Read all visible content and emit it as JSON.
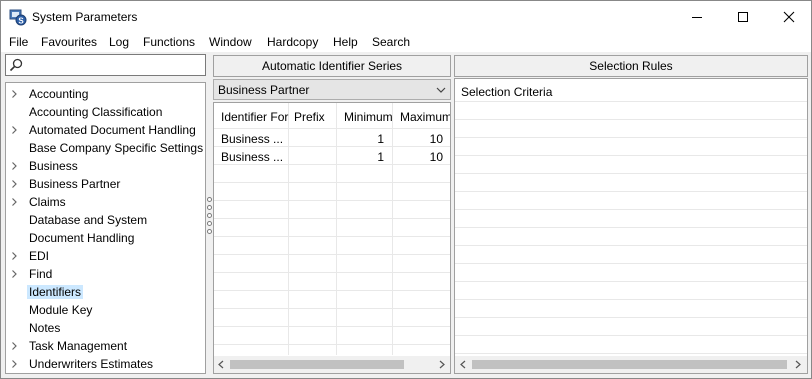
{
  "window": {
    "title": "System Parameters"
  },
  "menu": [
    "File",
    "Favourites",
    "Log",
    "Functions",
    "Window",
    "Hardcopy",
    "Help",
    "Search"
  ],
  "search": {
    "value": "",
    "placeholder": ""
  },
  "tree": {
    "items": [
      {
        "label": "Accounting",
        "expandable": true
      },
      {
        "label": "Accounting Classification",
        "expandable": false
      },
      {
        "label": "Automated Document Handling",
        "expandable": true
      },
      {
        "label": "Base Company Specific Settings",
        "expandable": false
      },
      {
        "label": "Business",
        "expandable": true
      },
      {
        "label": "Business Partner",
        "expandable": true
      },
      {
        "label": "Claims",
        "expandable": true
      },
      {
        "label": "Database and System",
        "expandable": false
      },
      {
        "label": "Document Handling",
        "expandable": false
      },
      {
        "label": "EDI",
        "expandable": true
      },
      {
        "label": "Find",
        "expandable": true
      },
      {
        "label": "Identifiers",
        "expandable": false,
        "selected": true
      },
      {
        "label": "Module Key",
        "expandable": false
      },
      {
        "label": "Notes",
        "expandable": false
      },
      {
        "label": "Task Management",
        "expandable": true
      },
      {
        "label": "Underwriters Estimates",
        "expandable": true
      }
    ]
  },
  "identifier_series": {
    "header": "Automatic Identifier Series",
    "combo_value": "Business Partner",
    "columns": [
      "Identifier For",
      "Prefix",
      "Minimum",
      "Maximum"
    ],
    "rows": [
      [
        "Business ...",
        "",
        "1",
        "10"
      ],
      [
        "Business ...",
        "",
        "1",
        "10"
      ]
    ]
  },
  "selection_rules": {
    "header": "Selection Rules",
    "criteria_label": "Selection Criteria"
  },
  "colors": {
    "selection": "#cce8ff",
    "panel_bg": "#f0f0f0",
    "border": "#a0a0a0"
  },
  "icons": [
    "app-icon",
    "minimize-icon",
    "maximize-icon",
    "close-icon",
    "search-icon",
    "chevron-right-icon",
    "chevron-down-icon",
    "scroll-left-icon",
    "scroll-right-icon"
  ]
}
